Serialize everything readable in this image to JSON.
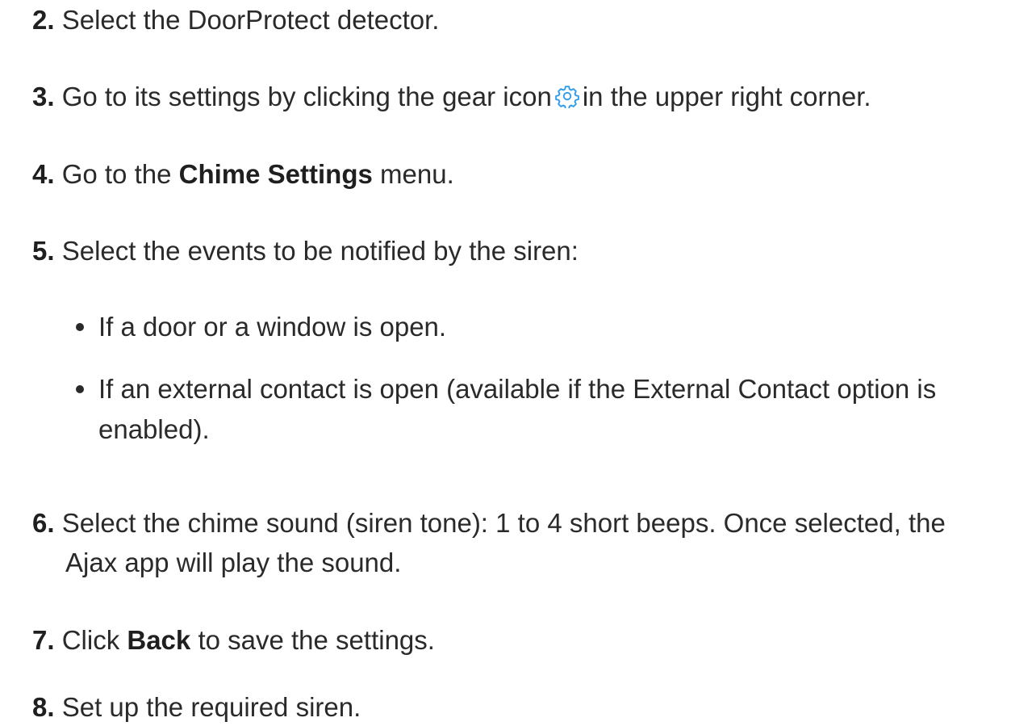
{
  "steps": [
    {
      "num": "2.",
      "pre": "Select the DoorProtect detector."
    },
    {
      "num": "3.",
      "pre": "Go to its settings by clicking the gear icon",
      "post": "in the upper right corner."
    },
    {
      "num": "4.",
      "pre": "Go to the",
      "bold": "Chime Settings",
      "post": "menu."
    },
    {
      "num": "5.",
      "pre": "Select the events to be notified by the siren:"
    },
    {
      "num": "6.",
      "line1": "Select the chime sound (siren tone): 1 to 4 short beeps. Once selected, the",
      "line2": "Ajax app will play the sound."
    },
    {
      "num": "7.",
      "pre": "Click",
      "bold": "Back",
      "post": "to save the settings."
    },
    {
      "num": "8.",
      "pre": "Set up the required siren."
    }
  ],
  "bullets": [
    {
      "line1": "If a door or a window is open."
    },
    {
      "line1": "If an external contact is open (available if the External Contact option is",
      "line2": "enabled)."
    }
  ],
  "colors": {
    "text": "#2a2a2a",
    "gear_icon": "#2f9be8"
  },
  "icons": {
    "gear": "gear-icon"
  }
}
